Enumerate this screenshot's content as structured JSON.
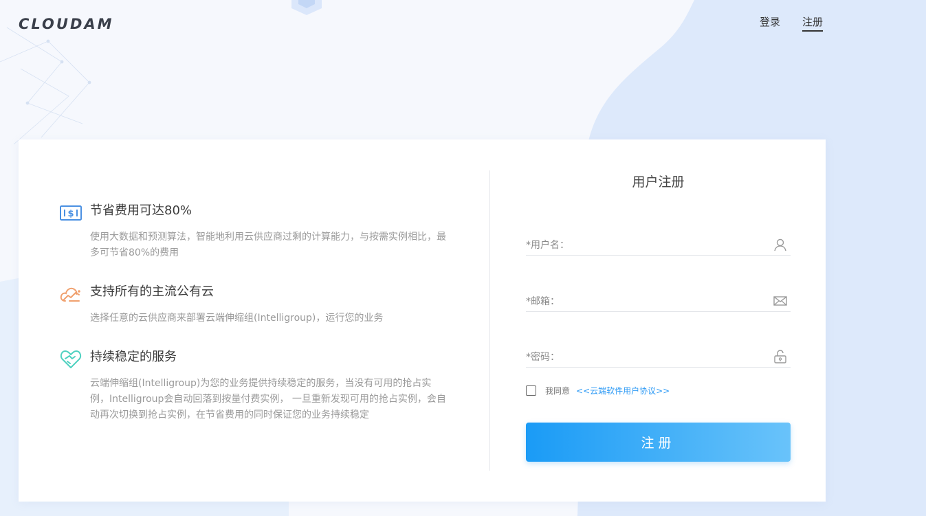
{
  "brand": {
    "logo_text": "CLOUDAM"
  },
  "nav": {
    "login_label": "登录",
    "register_label": "注册"
  },
  "features": [
    {
      "icon": "dollar-card-icon",
      "title": "节省费用可达80%",
      "desc": "使用大数据和预测算法，智能地利用云供应商过剩的计算能力，与按需实例相比，最多可节省80%的费用"
    },
    {
      "icon": "cloud-chart-icon",
      "title": "支持所有的主流公有云",
      "desc": "选择任意的云供应商来部署云端伸缩组(Intelligroup)，运行您的业务"
    },
    {
      "icon": "heart-handshake-icon",
      "title": "持续稳定的服务",
      "desc": "云端伸缩组(Intelligroup)为您的业务提供持续稳定的服务，当没有可用的抢占实例，Intelligroup会自动回落到按量付费实例， 一旦重新发现可用的抢占实例，会自动再次切换到抢占实例，在节省费用的同时保证您的业务持续稳定"
    }
  ],
  "form": {
    "title": "用户注册",
    "username": {
      "label": "*用户名：",
      "value": "",
      "icon": "user-icon"
    },
    "email": {
      "label": "*邮箱：",
      "value": "",
      "icon": "envelope-icon"
    },
    "password": {
      "label": "*密码：",
      "value": "",
      "icon": "lock-icon"
    },
    "agree_text": "我同意",
    "agreement_link": "<<云端软件用户协议>>",
    "agreed": false,
    "submit_label": "注册"
  },
  "colors": {
    "accent": "#1a9bf6",
    "accent_light": "#69c3fa",
    "link": "#2f9bf5",
    "icon_blue": "#4a90e2",
    "icon_orange": "#f0a06e",
    "icon_teal": "#4fd1c0"
  }
}
